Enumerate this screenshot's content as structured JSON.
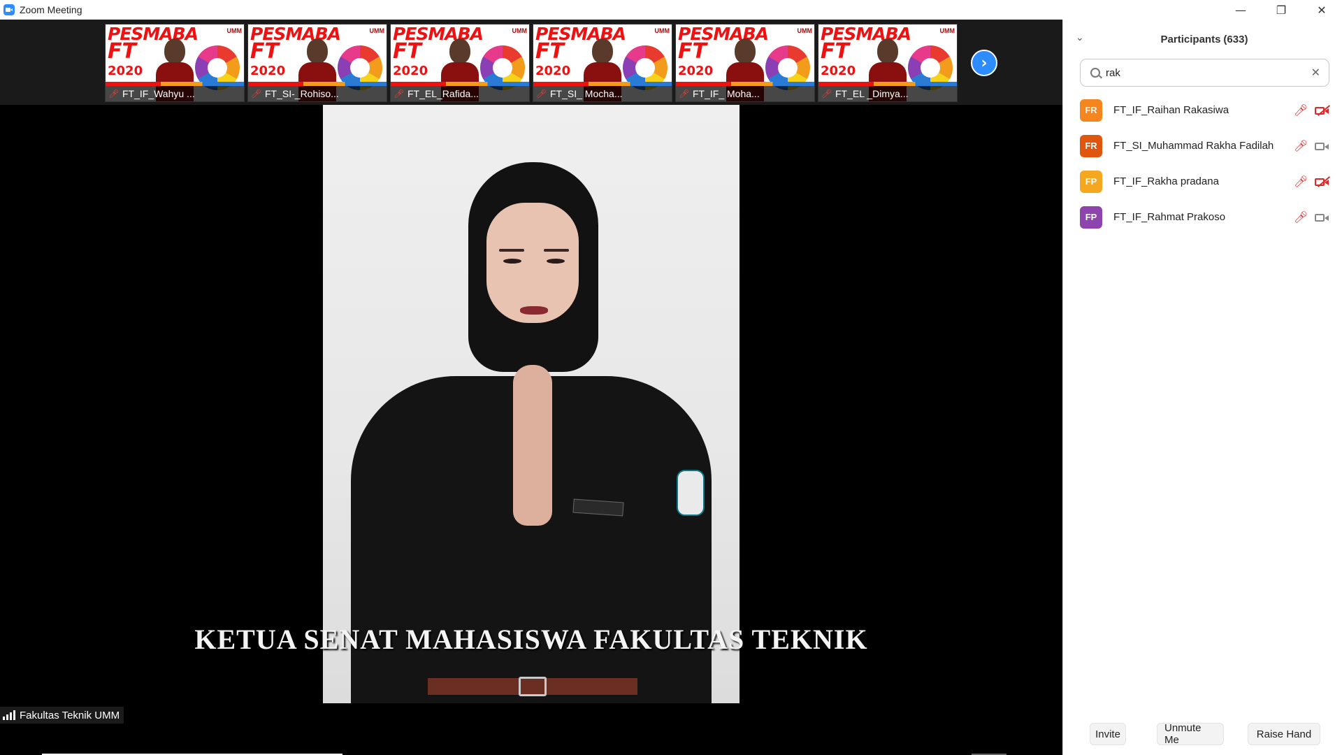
{
  "window": {
    "title": "Zoom Meeting",
    "controls": {
      "minimize": "—",
      "restore": "❐",
      "close": "✕"
    }
  },
  "thumbnails": [
    {
      "name": "FT_IF_Wahyu ...",
      "banner": "PESMABA",
      "banner_ft": "FT",
      "year": "2020",
      "umm": "UMM"
    },
    {
      "name": "FT_SI-_Rohiso...",
      "banner": "PESMABA",
      "banner_ft": "FT",
      "year": "2020",
      "umm": "UMM"
    },
    {
      "name": "FT_EL_Rafida...",
      "banner": "PESMABA",
      "banner_ft": "FT",
      "year": "2020",
      "umm": "UMM"
    },
    {
      "name": "FT_SI_ Mocha...",
      "banner": "PESMABA",
      "banner_ft": "FT",
      "year": "2020",
      "umm": "UMM"
    },
    {
      "name": "FT_IF_ Moha...",
      "banner": "PESMABA",
      "banner_ft": "FT",
      "year": "2020",
      "umm": "UMM"
    },
    {
      "name": "FT_EL _Dimya...",
      "banner": "PESMABA",
      "banner_ft": "FT",
      "year": "2020",
      "umm": "UMM"
    }
  ],
  "main_video": {
    "caption": "KETUA SENAT MAHASISWA FAKULTAS TEKNIK",
    "host_label": "Fakultas Teknik UMM"
  },
  "participants_panel": {
    "title": "Participants",
    "count": "(633)",
    "search": {
      "value": "rak"
    },
    "participants": [
      {
        "initials": "FR",
        "name": "FT_IF_Raihan Rakasiwa",
        "avatar_color": "#f5861f",
        "muted": true,
        "video_off": true
      },
      {
        "initials": "FR",
        "name": "FT_SI_Muhammad Rakha Fadilah",
        "avatar_color": "#e0560e",
        "muted": true,
        "video_off": false
      },
      {
        "initials": "FP",
        "name": "FT_IF_Rakha pradana",
        "avatar_color": "#f5a81f",
        "muted": true,
        "video_off": true
      },
      {
        "initials": "FP",
        "name": "FT_IF_Rahmat Prakoso",
        "avatar_color": "#8e44ad",
        "muted": true,
        "video_off": false
      }
    ],
    "footer": {
      "invite": "Invite",
      "unmute": "Unmute Me",
      "raise_hand": "Raise Hand"
    }
  },
  "colors": {
    "accent": "#2d8cff",
    "muted_red": "#e02828",
    "video_bg": "#000000"
  }
}
